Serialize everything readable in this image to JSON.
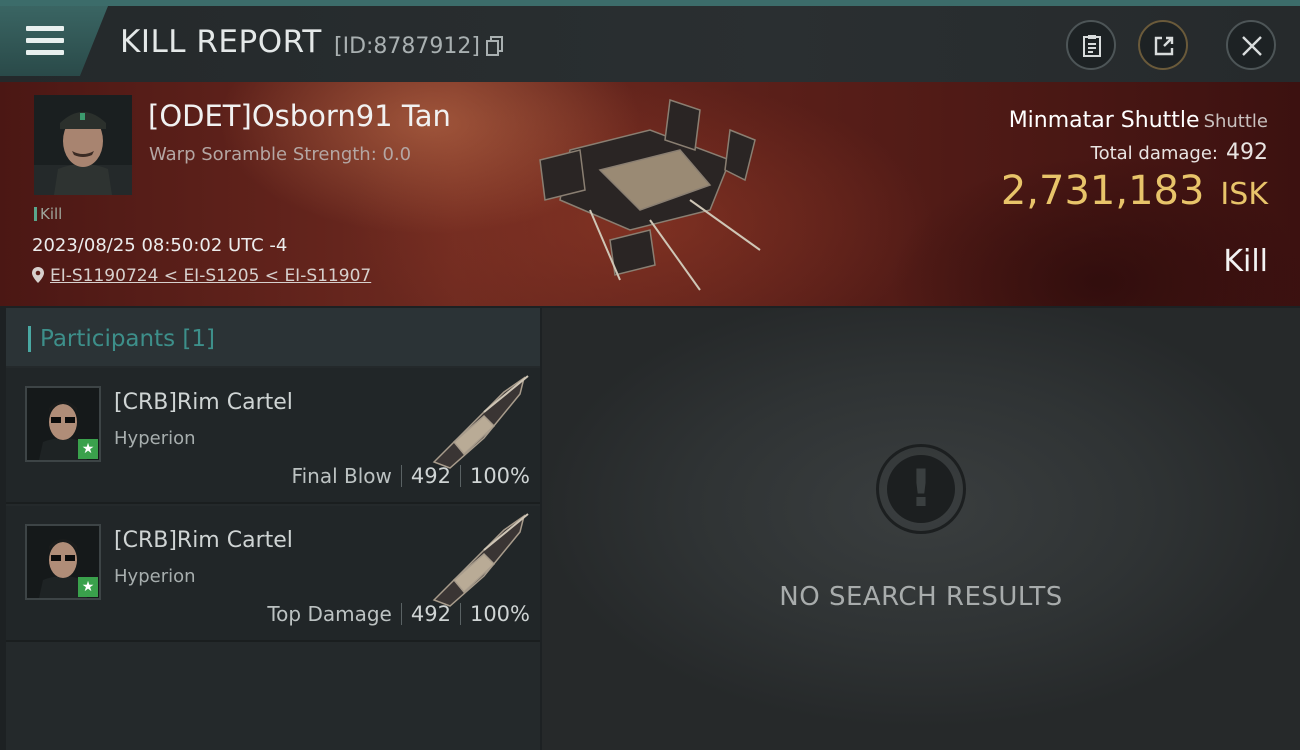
{
  "header": {
    "title": "KILL REPORT",
    "report_id": "[ID:8787912]",
    "icons": {
      "menu": "hamburger-menu-icon",
      "copy": "copy-icon",
      "clipboard": "clipboard-icon",
      "share": "share-icon",
      "close": "close-icon"
    }
  },
  "victim": {
    "name": "[ODET]Osborn91 Tan",
    "warp_scramble": "Warp Soramble Strength: 0.0",
    "kill_tag": "Kill",
    "datetime": "2023/08/25 08:50:02 UTC -4",
    "location": "EI-S1190724 < EI-S1205 < EI-S11907"
  },
  "loss": {
    "ship_name": "Minmatar Shuttle",
    "ship_class": "Shuttle",
    "total_damage_label": "Total damage:",
    "total_damage": "492",
    "isk_value": "2,731,183",
    "isk_unit": "ISK",
    "result": "Kill"
  },
  "participants": {
    "header": "Participants [1]",
    "rows": [
      {
        "name": "[CRB]Rim Cartel",
        "ship": "Hyperion",
        "role": "Final Blow",
        "damage": "492",
        "percent": "100%"
      },
      {
        "name": "[CRB]Rim Cartel",
        "ship": "Hyperion",
        "role": "Top Damage",
        "damage": "492",
        "percent": "100%"
      }
    ]
  },
  "search": {
    "empty_text": "NO SEARCH RESULTS"
  },
  "colors": {
    "accent": "#3d8f8a",
    "isk": "#e8c46a",
    "banner": "#6e2a20",
    "corp_badge": "#3aa14c"
  }
}
